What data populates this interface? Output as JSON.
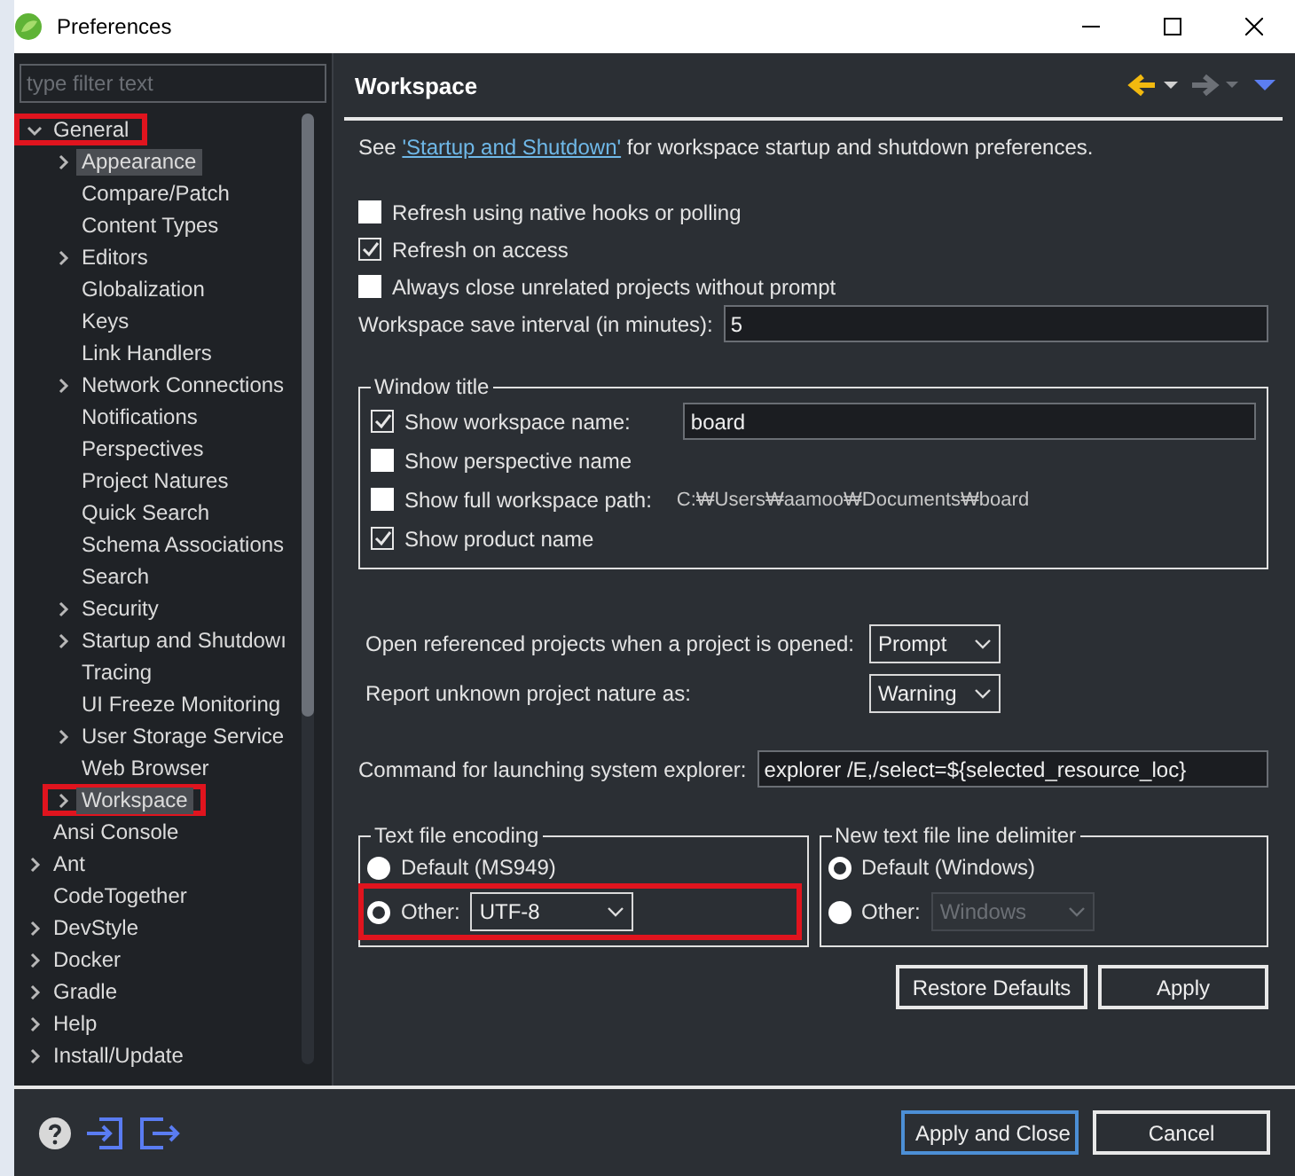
{
  "window": {
    "title": "Preferences"
  },
  "filter": {
    "placeholder": "type filter text"
  },
  "tree": [
    {
      "label": "General",
      "expanded": true,
      "selected": false,
      "highlighted": true,
      "children": [
        {
          "label": "Appearance",
          "expandable": true,
          "selected": true,
          "highlighted": false
        },
        {
          "label": "Compare/Patch",
          "expandable": false,
          "selected": false,
          "highlighted": false
        },
        {
          "label": "Content Types",
          "expandable": false,
          "selected": false,
          "highlighted": false
        },
        {
          "label": "Editors",
          "expandable": true,
          "selected": false,
          "highlighted": false
        },
        {
          "label": "Globalization",
          "expandable": false,
          "selected": false,
          "highlighted": false
        },
        {
          "label": "Keys",
          "expandable": false,
          "selected": false,
          "highlighted": false
        },
        {
          "label": "Link Handlers",
          "expandable": false,
          "selected": false,
          "highlighted": false
        },
        {
          "label": "Network Connections",
          "expandable": true,
          "selected": false,
          "highlighted": false
        },
        {
          "label": "Notifications",
          "expandable": false,
          "selected": false,
          "highlighted": false
        },
        {
          "label": "Perspectives",
          "expandable": false,
          "selected": false,
          "highlighted": false
        },
        {
          "label": "Project Natures",
          "expandable": false,
          "selected": false,
          "highlighted": false
        },
        {
          "label": "Quick Search",
          "expandable": false,
          "selected": false,
          "highlighted": false
        },
        {
          "label": "Schema Associations",
          "expandable": false,
          "selected": false,
          "highlighted": false
        },
        {
          "label": "Search",
          "expandable": false,
          "selected": false,
          "highlighted": false
        },
        {
          "label": "Security",
          "expandable": true,
          "selected": false,
          "highlighted": false
        },
        {
          "label": "Startup and Shutdowı",
          "expandable": true,
          "selected": false,
          "highlighted": false
        },
        {
          "label": "Tracing",
          "expandable": false,
          "selected": false,
          "highlighted": false
        },
        {
          "label": "UI Freeze Monitoring",
          "expandable": false,
          "selected": false,
          "highlighted": false
        },
        {
          "label": "User Storage Service",
          "expandable": true,
          "selected": false,
          "highlighted": false
        },
        {
          "label": "Web Browser",
          "expandable": false,
          "selected": false,
          "highlighted": false
        },
        {
          "label": "Workspace",
          "expandable": true,
          "selected": true,
          "highlighted": true
        }
      ]
    },
    {
      "label": "Ansi Console",
      "expanded": false,
      "expandable": false,
      "selected": false,
      "highlighted": false
    },
    {
      "label": "Ant",
      "expanded": false,
      "expandable": true,
      "selected": false,
      "highlighted": false
    },
    {
      "label": "CodeTogether",
      "expanded": false,
      "expandable": false,
      "selected": false,
      "highlighted": false
    },
    {
      "label": "DevStyle",
      "expanded": false,
      "expandable": true,
      "selected": false,
      "highlighted": false
    },
    {
      "label": "Docker",
      "expanded": false,
      "expandable": true,
      "selected": false,
      "highlighted": false
    },
    {
      "label": "Gradle",
      "expanded": false,
      "expandable": true,
      "selected": false,
      "highlighted": false
    },
    {
      "label": "Help",
      "expanded": false,
      "expandable": true,
      "selected": false,
      "highlighted": false
    },
    {
      "label": "Install/Update",
      "expanded": false,
      "expandable": true,
      "selected": false,
      "highlighted": false
    }
  ],
  "page": {
    "title": "Workspace",
    "intro": {
      "before": "See",
      "link": "'Startup and Shutdown'",
      "after": "for workspace startup and shutdown preferences."
    },
    "options": [
      {
        "label": "Refresh using native hooks or polling",
        "checked": false
      },
      {
        "label": "Refresh on access",
        "checked": true
      },
      {
        "label": "Always close unrelated projects without prompt",
        "checked": false
      }
    ],
    "save_interval": {
      "label": "Workspace save interval (in minutes):",
      "value": "5"
    },
    "window_title": {
      "legend": "Window title",
      "items": [
        {
          "kind": "input",
          "label": "Show workspace name:",
          "checked": true,
          "value": "board"
        },
        {
          "kind": "plain",
          "label": "Show perspective name",
          "checked": false
        },
        {
          "kind": "path",
          "label": "Show full workspace path:",
          "checked": false,
          "value": "C:₩Users₩aamoo₩Documents₩board"
        },
        {
          "kind": "plain",
          "label": "Show product name",
          "checked": true
        }
      ]
    },
    "selects": [
      {
        "label": "Open referenced projects when a project is opened:",
        "value": "Prompt"
      },
      {
        "label": "Report unknown project nature as:",
        "value": "Warning"
      }
    ],
    "explorer": {
      "label": "Command for launching system explorer:",
      "value": "explorer /E,/select=${selected_resource_loc}"
    },
    "encoding": {
      "legend": "Text file encoding",
      "options": [
        {
          "label": "Default (MS949)",
          "selected": false,
          "highlighted": false
        },
        {
          "label": "Other:",
          "selected": true,
          "highlighted": true,
          "value": "UTF-8",
          "disabled": false
        }
      ]
    },
    "delimiter": {
      "legend": "New text file line delimiter",
      "options": [
        {
          "label": "Default (Windows)",
          "selected": true,
          "highlighted": false
        },
        {
          "label": "Other:",
          "selected": false,
          "highlighted": false,
          "value": "Windows",
          "disabled": true
        }
      ]
    },
    "buttons": [
      "Restore Defaults",
      "Apply"
    ]
  },
  "footer": {
    "buttons": [
      {
        "label": "Apply and Close",
        "default": true
      },
      {
        "label": "Cancel",
        "default": false
      }
    ]
  }
}
